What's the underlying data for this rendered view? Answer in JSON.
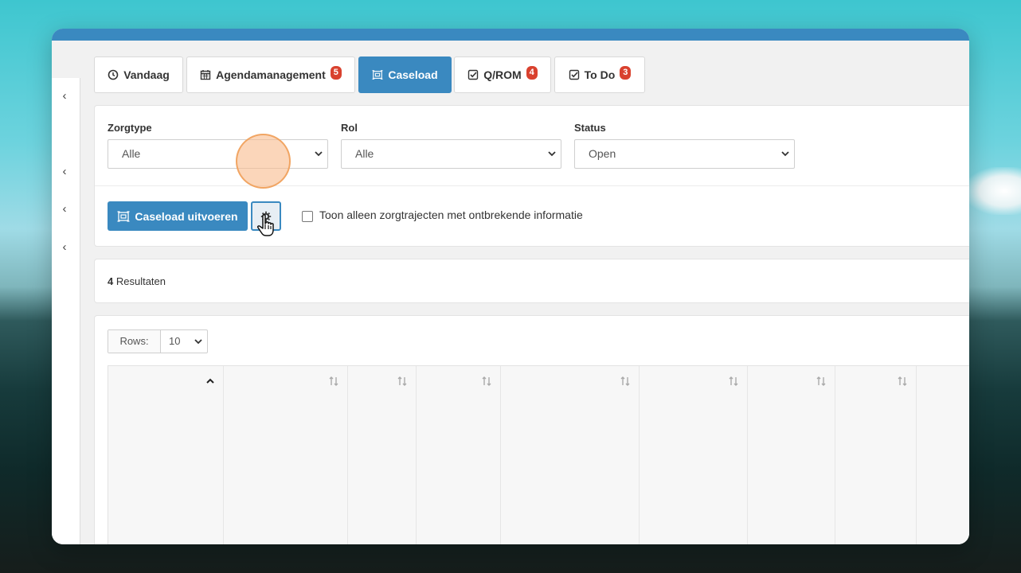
{
  "tabs": [
    {
      "label": "Vandaag",
      "icon": "clock-icon",
      "active": false
    },
    {
      "label": "Agendamanagement",
      "icon": "calendar-icon",
      "badge": "5",
      "active": false
    },
    {
      "label": "Caseload",
      "icon": "caseload-icon",
      "active": true
    },
    {
      "label": "Q/ROM",
      "icon": "check-square-icon",
      "badge": "4",
      "active": false
    },
    {
      "label": "To Do",
      "icon": "check-square-icon",
      "badge": "3",
      "active": false
    }
  ],
  "filters": {
    "zorgtype": {
      "label": "Zorgtype",
      "value": "Alle"
    },
    "rol": {
      "label": "Rol",
      "value": "Alle"
    },
    "status": {
      "label": "Status",
      "value": "Open"
    }
  },
  "actions": {
    "run_label": "Caseload uitvoeren",
    "checkbox_label": "Toon alleen zorgtrajecten met ontbrekende informatie",
    "checkbox_checked": false
  },
  "results": {
    "count": "4",
    "label": " Resultaten"
  },
  "table": {
    "rows_label": "Rows:",
    "rows_value": "10"
  },
  "colors": {
    "primary": "#3a89c0",
    "badge": "#d9412e",
    "click_indicator": "#f8ba8c"
  }
}
